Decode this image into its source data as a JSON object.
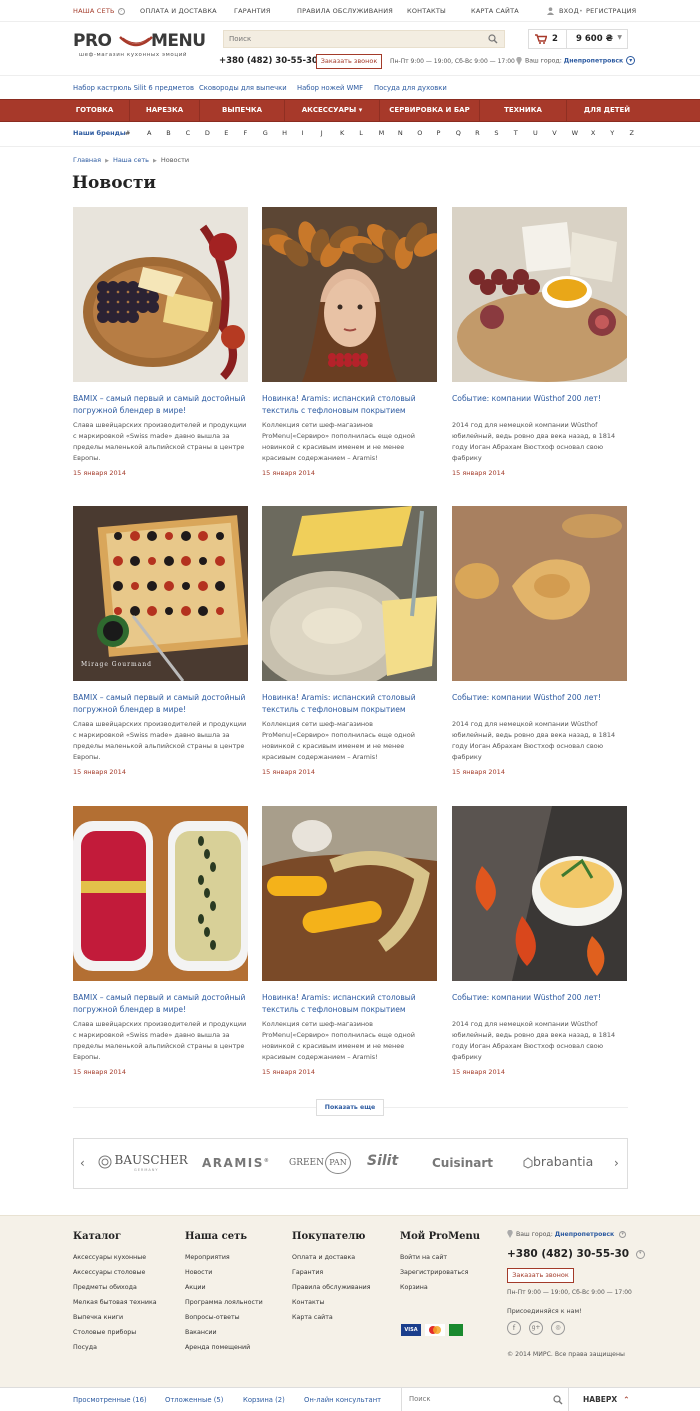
{
  "topbar": {
    "network": "Наша сеть",
    "items": [
      "Оплата и доставка",
      "Гарантия",
      "Правила обслуживания",
      "Контакты",
      "Карта сайта"
    ],
    "login": "Вход",
    "separator": "•",
    "register": "Регистрация"
  },
  "logo": {
    "part1": "PRO",
    "part2": "MENU",
    "tagline": "шеф-магазин кухонных эмоций"
  },
  "search": {
    "placeholder": "Поиск"
  },
  "header": {
    "phone": "+380 (482) 30-55-30",
    "call_button": "Заказать звонок",
    "hours": "Пн-Пт 9:00 — 19:00, Сб-Вс 9:00 — 17:00",
    "cart_count": "2",
    "cart_sum": "9 600 ₴",
    "city_label": "Ваш город:",
    "city": "Днепропетровск"
  },
  "quick_links": [
    "Набор кастрюль Silit 6 предметов",
    "Сковороды для выпечки",
    "Набор ножей WMF",
    "Посуда для духовки"
  ],
  "nav": [
    "Готовка",
    "Нарезка",
    "Выпечка",
    "Аксессуары ▾",
    "Сервировка и бар",
    "Техника",
    "Для детей"
  ],
  "brands_bar": {
    "label": "Наши бренды",
    "hash": "#",
    "letters": [
      "A",
      "B",
      "C",
      "D",
      "E",
      "F",
      "G",
      "H",
      "I",
      "J",
      "K",
      "L",
      "M",
      "N",
      "O",
      "P",
      "Q",
      "R",
      "S",
      "T",
      "U",
      "V",
      "W",
      "X",
      "Y",
      "Z"
    ]
  },
  "breadcrumb": {
    "home": "Главная",
    "network": "Наша сеть",
    "current": "Новости"
  },
  "page_title": "Новости",
  "news": [
    {
      "title": "BAMIX – самый первый и самый достойный погружной блендер в мире!",
      "desc": "Слава швейцарских производителей и продукции с маркировкой «Swiss made» давно вышла за пределы маленькой альпийской страны в центре Европы.",
      "date": "15 января 2014",
      "image": "cheese-grapes-leaves"
    },
    {
      "title": "Новинка! Aramis: испанский столовый текстиль с тефлоновым покрытием",
      "desc": "Коллекция сети шеф-магазинов ProMenu|«Сервиро» пополнилась еще одной новинкой с красивым именем и не менее красивым содержанием – Aramis!",
      "date": "15 января 2014",
      "image": "autumn-wreath-girl"
    },
    {
      "title": "Событие: компании Wüsthof  200 лет!",
      "desc": "2014 год для немецкой компании Wüsthof юбилейный, ведь ровно два века назад, в 1814 году Иоган Абрахам Вюстхоф основал свою фабрику",
      "date": "15 января 2014",
      "image": "cheese-board-figs"
    },
    {
      "title": "BAMIX – самый первый и самый достойный погружной блендер в мире!",
      "desc": "Слава швейцарских производителей и продукции с маркировкой «Swiss made» давно вышла за пределы маленькой альпийской страны в центре Европы.",
      "date": "15 января 2014",
      "image": "pizza-olives"
    },
    {
      "title": "Новинка! Aramis: испанский столовый текстиль с тефлоновым покрытием",
      "desc": "Коллекция сети шеф-магазинов ProMenu|«Сервиро» пополнилась еще одной новинкой с красивым именем и не менее красивым содержанием – Aramis!",
      "date": "15 января 2014",
      "image": "cheese-plate-knife"
    },
    {
      "title": "Событие: компании Wüsthof  200 лет!",
      "desc": "2014 год для немецкой компании Wüsthof юбилейный, ведь ровно два века назад, в 1814 году Иоган Абрахам Вюстхоф основал свою фабрику",
      "date": "15 января 2014",
      "image": "ravioli"
    },
    {
      "title": "BAMIX – самый первый и самый достойный погружной блендер в мире!",
      "desc": "Слава швейцарских производителей и продукции с маркировкой «Swiss made» давно вышла за пределы маленькой альпийской страны в центре Европы.",
      "date": "15 января 2014",
      "image": "soups-seeds"
    },
    {
      "title": "Новинка! Aramis: испанский столовый текстиль с тефлоновым покрытием",
      "desc": "Коллекция сети шеф-магазинов ProMenu|«Сервиро» пополнилась еще одной новинкой с красивым именем и не менее красивым содержанием – Aramis!",
      "date": "15 января 2014",
      "image": "corn-cobs"
    },
    {
      "title": "Событие: компании Wüsthof  200 лет!",
      "desc": "2014 год для немецкой компании Wüsthof юбилейный, ведь ровно два века назад, в 1814 году Иоган Абрахам Вюстхоф основал свою фабрику",
      "date": "15 января 2014",
      "image": "mash-physalis"
    }
  ],
  "image_texts": {
    "pizza": "Mirage Gourmand"
  },
  "show_more": "Показать еще",
  "brand_logos": [
    "BAUSCHER",
    "GERMANY",
    "ARAMIS",
    "®",
    "GREEN",
    "PAN",
    "Silit",
    "Cuisinart",
    "brabantia"
  ],
  "footer": {
    "columns": [
      {
        "title": "Каталог",
        "items": [
          "Аксессуары кухонные",
          "Аксессуары столовые",
          "Предметы обихода",
          "Мелкая бытовая техника",
          "Выпечка книги",
          "Столовые приборы",
          "Посуда"
        ]
      },
      {
        "title": "Наша сеть",
        "items": [
          "Мероприятия",
          "Новости",
          "Акции",
          "Программа лояльности",
          "Вопросы-ответы",
          "Вакансии",
          "Аренда помещений"
        ]
      },
      {
        "title": "Покупателю",
        "items": [
          "Оплата и доставка",
          "Гарантия",
          "Правила обслуживания",
          "Контакты",
          "Карта сайта"
        ]
      },
      {
        "title": "Мой ProMenu",
        "items": [
          "Войти на сайт",
          "Зарегистрироваться",
          "Корзина"
        ]
      }
    ],
    "city_label": "Ваш город:",
    "city": "Днепропетровск",
    "phone": "+380 (482) 30-55-30",
    "call_button": "Заказать звонок",
    "hours": "Пн-Пт 9:00 — 19:00, Сб-Вс 9:00 — 17:00",
    "join": "Присоединяйся к нам!",
    "payments": [
      "VISA",
      "MC",
      ""
    ],
    "copyright": "© 2014 МИРС. Все права защищены"
  },
  "bottom_bar": {
    "viewed": "Просмотренные (16)",
    "postponed": "Отложенные (5)",
    "cart": "Корзина (2)",
    "consultant": "Он-лайн консультант",
    "search_placeholder": "Поиск",
    "up": "Наверх",
    "up_arrow": "⌃"
  },
  "colors": {
    "accent_red": "#a7392a",
    "link_blue": "#2c5aa0",
    "footer_bg": "#f5f1e8"
  }
}
